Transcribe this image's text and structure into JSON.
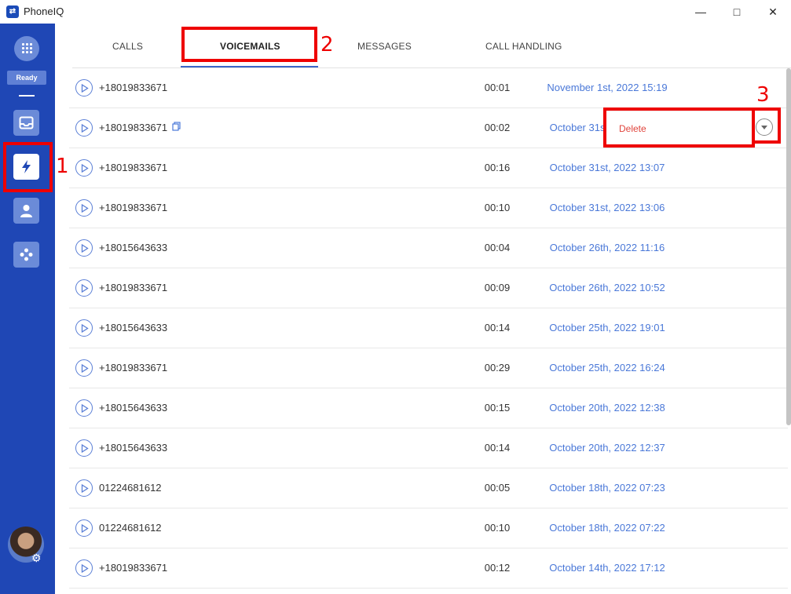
{
  "window": {
    "title": "PhoneIQ",
    "logo_text": "⇄",
    "min": "—",
    "max": "□",
    "close": "✕"
  },
  "sidebar": {
    "status": "Ready",
    "nav": [
      {
        "name": "inbox-icon",
        "active": false
      },
      {
        "name": "flash-icon",
        "active": true
      },
      {
        "name": "contact-icon",
        "active": false
      },
      {
        "name": "apps-icon",
        "active": false
      }
    ],
    "settings_glyph": "⚙"
  },
  "tabs": [
    {
      "label": "CALLS"
    },
    {
      "label": "VOICEMAILS"
    },
    {
      "label": "MESSAGES"
    },
    {
      "label": "CALL HANDLING"
    }
  ],
  "voicemails": [
    {
      "number": "+18019833671",
      "duration": "00:01",
      "date": "November 1st, 2022 15:19"
    },
    {
      "number": "+18019833671",
      "duration": "00:02",
      "date": "October 31st, 2022 13:07"
    },
    {
      "number": "+18019833671",
      "duration": "00:16",
      "date": "October 31st, 2022 13:07"
    },
    {
      "number": "+18019833671",
      "duration": "00:10",
      "date": "October 31st, 2022 13:06"
    },
    {
      "number": "+18015643633",
      "duration": "00:04",
      "date": "October 26th, 2022 11:16"
    },
    {
      "number": "+18019833671",
      "duration": "00:09",
      "date": "October 26th, 2022 10:52"
    },
    {
      "number": "+18015643633",
      "duration": "00:14",
      "date": "October 25th, 2022 19:01"
    },
    {
      "number": "+18019833671",
      "duration": "00:29",
      "date": "October 25th, 2022 16:24"
    },
    {
      "number": "+18015643633",
      "duration": "00:15",
      "date": "October 20th, 2022 12:38"
    },
    {
      "number": "+18015643633",
      "duration": "00:14",
      "date": "October 20th, 2022 12:37"
    },
    {
      "number": "01224681612",
      "duration": "00:05",
      "date": "October 18th, 2022 07:23"
    },
    {
      "number": "01224681612",
      "duration": "00:10",
      "date": "October 18th, 2022 07:22"
    },
    {
      "number": "+18019833671",
      "duration": "00:12",
      "date": "October 14th, 2022 17:12"
    }
  ],
  "context_menu": {
    "delete_label": "Delete"
  },
  "annotations": [
    "1",
    "2",
    "3"
  ],
  "colors": {
    "sidebar": "#1f47b5",
    "accent": "#4a78d8",
    "annotation": "#ee0000",
    "delete": "#e0443c"
  }
}
